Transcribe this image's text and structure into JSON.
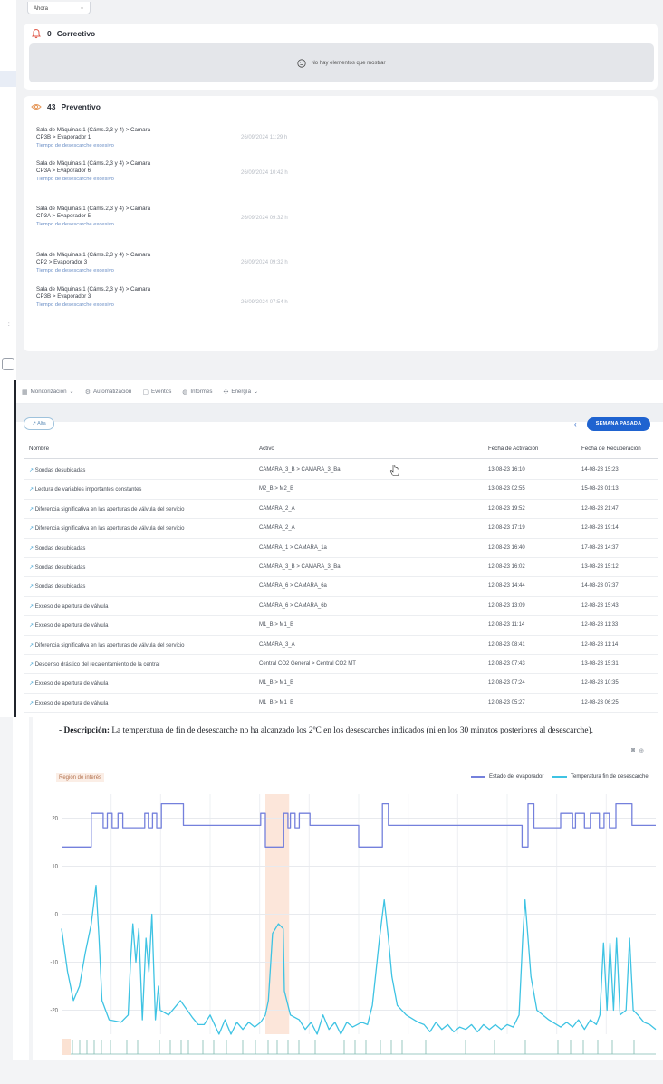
{
  "maintenance": {
    "top_select_label": "Ahora",
    "corrective": {
      "count": "0",
      "title": "Correctivo",
      "empty_text": "No hay elementos que mostrar"
    },
    "preventive": {
      "count": "43",
      "title": "Preventivo",
      "items": [
        {
          "asset": "Sala de Máquinas 1 (Cáms.2,3 y 4) > Camara CP3B > Evaporador 1",
          "type": "Tiempo de desescarche excesivo",
          "date": "26/09/2024 11:29 h"
        },
        {
          "asset": "Sala de Máquinas 1 (Cáms.2,3 y 4) > Camara CP3A > Evaporador 6",
          "type": "Tiempo de desescarche excesivo",
          "date": "26/09/2024 10:42 h"
        },
        {
          "asset": "Sala de Máquinas 1 (Cáms.2,3 y 4) > Camara CP3A > Evaporador 5",
          "type": "Tiempo de desescarche excesivo",
          "date": "26/09/2024 09:32 h"
        },
        {
          "asset": "Sala de Máquinas 1 (Cáms.2,3 y 4) > Camara CP2 > Evaporador 3",
          "type": "Tiempo de desescarche excesivo",
          "date": "26/09/2024 09:32 h"
        },
        {
          "asset": "Sala de Máquinas 1 (Cáms.2,3 y 4) > Camara CP3B > Evaporador 3",
          "type": "Tiempo de desescarche excesivo",
          "date": "26/09/2024 07:54 h"
        }
      ]
    }
  },
  "events": {
    "nav": [
      {
        "label": "Monitorización",
        "icon": "grid-icon",
        "glyph": "▦",
        "dropdown": true
      },
      {
        "label": "Automatización",
        "icon": "gear-icon",
        "glyph": "⚙",
        "dropdown": false
      },
      {
        "label": "Eventos",
        "icon": "document-icon",
        "glyph": "▢",
        "dropdown": false
      },
      {
        "label": "Informes",
        "icon": "report-icon",
        "glyph": "◍",
        "dropdown": false
      },
      {
        "label": "Energía",
        "icon": "energy-icon",
        "glyph": "✣",
        "dropdown": true
      }
    ],
    "filter_pill": "Alta",
    "week_button": "SEMANA PASADA",
    "columns": [
      "Nombre",
      "Activo",
      "Fecha de Activación",
      "Fecha de Recuperación"
    ],
    "rows": [
      {
        "name": "Sondas desubicadas",
        "asset": "CAMARA_3_B > CAMARA_3_Ba",
        "activation": "13-08-23 16:10",
        "recovery": "14-08-23 15:23"
      },
      {
        "name": "Lectura de variables importantes constantes",
        "asset": "M2_B > M2_B",
        "activation": "13-08-23 02:55",
        "recovery": "15-08-23 01:13"
      },
      {
        "name": "Diferencia significativa en las aperturas de válvula del servicio",
        "asset": "CAMARA_2_A",
        "activation": "12-08-23 19:52",
        "recovery": "12-08-23 21:47"
      },
      {
        "name": "Diferencia significativa en las aperturas de válvula del servicio",
        "asset": "CAMARA_2_A",
        "activation": "12-08-23 17:19",
        "recovery": "12-08-23 19:14"
      },
      {
        "name": "Sondas desubicadas",
        "asset": "CAMARA_1 > CAMARA_1a",
        "activation": "12-08-23 16:40",
        "recovery": "17-08-23 14:37"
      },
      {
        "name": "Sondas desubicadas",
        "asset": "CAMARA_3_B > CAMARA_3_Ba",
        "activation": "12-08-23 16:02",
        "recovery": "13-08-23 15:12"
      },
      {
        "name": "Sondas desubicadas",
        "asset": "CAMARA_6 > CAMARA_6a",
        "activation": "12-08-23 14:44",
        "recovery": "14-08-23 07:37"
      },
      {
        "name": "Exceso de apertura de válvula",
        "asset": "CAMARA_6 > CAMARA_6b",
        "activation": "12-08-23 13:09",
        "recovery": "12-08-23 15:43"
      },
      {
        "name": "Exceso de apertura de válvula",
        "asset": "M1_B > M1_B",
        "activation": "12-08-23 11:14",
        "recovery": "12-08-23 11:33"
      },
      {
        "name": "Diferencia significativa en las aperturas de válvula del servicio",
        "asset": "CAMARA_3_A",
        "activation": "12-08-23 08:41",
        "recovery": "12-08-23 11:14"
      },
      {
        "name": "Descenso drástico del recalentamiento de la central",
        "asset": "Central CO2 General > Central CO2 MT",
        "activation": "12-08-23 07:43",
        "recovery": "13-08-23 15:31"
      },
      {
        "name": "Exceso de apertura de válvula",
        "asset": "M1_B > M1_B",
        "activation": "12-08-23 07:24",
        "recovery": "12-08-23 10:35"
      },
      {
        "name": "Exceso de apertura de válvula",
        "asset": "M1_B > M1_B",
        "activation": "12-08-23 05:27",
        "recovery": "12-08-23 06:25"
      }
    ]
  },
  "report": {
    "description_label": "- Descripción:",
    "description_text": "La temperatura de fin de desescarche no ha alcanzado los 2ºC en los desescarches indicados (ni en los 30 minutos posteriores al desescarche).",
    "roi_label": "Región de interés",
    "legend": [
      "Estado del evaporador",
      "Temperatura fin de desescarche"
    ],
    "tools": [
      "camera-icon",
      "zoom-icon"
    ]
  },
  "chart_data": {
    "type": "line",
    "title": "",
    "xlabel": "",
    "ylabel": "",
    "ylim": [
      -25,
      25
    ],
    "yticks": [
      20,
      10,
      0,
      -10,
      -20
    ],
    "grid": true,
    "legend_position": "top-right",
    "x_range": [
      0,
      100
    ],
    "highlight_x": [
      [
        34.3,
        38.3
      ]
    ],
    "series": [
      {
        "name": "Estado del evaporador",
        "color": "#7480dc",
        "steps": [
          [
            0,
            14
          ],
          [
            5,
            14
          ],
          [
            5,
            21
          ],
          [
            7,
            21
          ],
          [
            7,
            18
          ],
          [
            7.7,
            18
          ],
          [
            7.7,
            21
          ],
          [
            8.5,
            21
          ],
          [
            8.5,
            18
          ],
          [
            9.5,
            18
          ],
          [
            9.5,
            21
          ],
          [
            10.3,
            21
          ],
          [
            10.3,
            18
          ],
          [
            14,
            18
          ],
          [
            14,
            21
          ],
          [
            14.6,
            21
          ],
          [
            14.6,
            18
          ],
          [
            15.3,
            18
          ],
          [
            15.3,
            21
          ],
          [
            16,
            21
          ],
          [
            16,
            18
          ],
          [
            16.8,
            18
          ],
          [
            16.8,
            23
          ],
          [
            20.5,
            23
          ],
          [
            20.5,
            18.5
          ],
          [
            33.5,
            18.5
          ],
          [
            33.5,
            21
          ],
          [
            34.3,
            21
          ],
          [
            34.3,
            14
          ],
          [
            37.4,
            14
          ],
          [
            37.4,
            21
          ],
          [
            38.1,
            21
          ],
          [
            38.1,
            18
          ],
          [
            38.5,
            18
          ],
          [
            38.5,
            21
          ],
          [
            39.3,
            21
          ],
          [
            39.3,
            18
          ],
          [
            40,
            18
          ],
          [
            40,
            21
          ],
          [
            41.8,
            21
          ],
          [
            41.8,
            18.5
          ],
          [
            50,
            18.5
          ],
          [
            50,
            14
          ],
          [
            54,
            14
          ],
          [
            54,
            23
          ],
          [
            55,
            23
          ],
          [
            55,
            18.5
          ],
          [
            77.5,
            18.5
          ],
          [
            77.5,
            14
          ],
          [
            78.5,
            14
          ],
          [
            78.5,
            23
          ],
          [
            79.5,
            23
          ],
          [
            79.5,
            18
          ],
          [
            84,
            18
          ],
          [
            84,
            21
          ],
          [
            86,
            21
          ],
          [
            86,
            18
          ],
          [
            86.5,
            18
          ],
          [
            86.5,
            21
          ],
          [
            88,
            21
          ],
          [
            88,
            18
          ],
          [
            89,
            18
          ],
          [
            89,
            21
          ],
          [
            90.5,
            21
          ],
          [
            90.5,
            18
          ],
          [
            91.3,
            18
          ],
          [
            91.3,
            21
          ],
          [
            92.2,
            21
          ],
          [
            92.2,
            18
          ],
          [
            93.3,
            18
          ],
          [
            93.3,
            23
          ],
          [
            96,
            23
          ],
          [
            96,
            18.5
          ],
          [
            100,
            18.5
          ]
        ]
      },
      {
        "name": "Temperatura fin de desescarche",
        "color": "#3ec3e3",
        "points": [
          [
            0,
            -3
          ],
          [
            1,
            -12
          ],
          [
            2,
            -18
          ],
          [
            3,
            -15
          ],
          [
            4,
            -8
          ],
          [
            5,
            -2
          ],
          [
            5.8,
            6
          ],
          [
            6.3,
            -5
          ],
          [
            6.8,
            -18
          ],
          [
            8,
            -22
          ],
          [
            10,
            -22.5
          ],
          [
            11.2,
            -21
          ],
          [
            11.6,
            -10
          ],
          [
            12,
            -2
          ],
          [
            12.5,
            -10
          ],
          [
            13,
            -3
          ],
          [
            13.6,
            -22
          ],
          [
            14.2,
            -5
          ],
          [
            14.7,
            -12
          ],
          [
            15.2,
            0
          ],
          [
            15.8,
            -22
          ],
          [
            16.3,
            -15
          ],
          [
            16.6,
            -20
          ],
          [
            18,
            -21
          ],
          [
            20,
            -18
          ],
          [
            22,
            -21.5
          ],
          [
            23,
            -23
          ],
          [
            24,
            -23
          ],
          [
            25,
            -21
          ],
          [
            26.5,
            -25
          ],
          [
            27.5,
            -22
          ],
          [
            28.5,
            -25
          ],
          [
            29.5,
            -22.5
          ],
          [
            30.5,
            -24
          ],
          [
            31.5,
            -22.5
          ],
          [
            32.5,
            -23.5
          ],
          [
            33.5,
            -22.5
          ],
          [
            34.3,
            -21
          ],
          [
            34.8,
            -18
          ],
          [
            35.5,
            -4
          ],
          [
            36.5,
            -2
          ],
          [
            37.3,
            -3
          ],
          [
            37.5,
            -16
          ],
          [
            38.5,
            -21
          ],
          [
            40,
            -22
          ],
          [
            41,
            -24
          ],
          [
            42,
            -22.5
          ],
          [
            43,
            -25
          ],
          [
            44,
            -21
          ],
          [
            45,
            -24
          ],
          [
            46,
            -22.5
          ],
          [
            47,
            -25
          ],
          [
            48,
            -22.5
          ],
          [
            49,
            -23.5
          ],
          [
            50.5,
            -22.5
          ],
          [
            51.5,
            -23
          ],
          [
            52.3,
            -19
          ],
          [
            53.5,
            -5
          ],
          [
            54.3,
            3
          ],
          [
            55,
            -5
          ],
          [
            55.6,
            -13
          ],
          [
            56.5,
            -19
          ],
          [
            58,
            -21
          ],
          [
            60,
            -22.5
          ],
          [
            61,
            -23
          ],
          [
            62,
            -24.5
          ],
          [
            63,
            -22.5
          ],
          [
            64,
            -24
          ],
          [
            65,
            -23
          ],
          [
            66,
            -24.5
          ],
          [
            67,
            -23.5
          ],
          [
            68,
            -24
          ],
          [
            69,
            -23
          ],
          [
            70,
            -24.5
          ],
          [
            71,
            -23
          ],
          [
            72,
            -24
          ],
          [
            73,
            -23
          ],
          [
            74,
            -24
          ],
          [
            75,
            -23
          ],
          [
            76,
            -23.5
          ],
          [
            77,
            -21
          ],
          [
            77.6,
            -5
          ],
          [
            78,
            3
          ],
          [
            78.5,
            -5
          ],
          [
            79,
            -13
          ],
          [
            80,
            -20
          ],
          [
            82,
            -22
          ],
          [
            84,
            -23.5
          ],
          [
            85,
            -22.5
          ],
          [
            86,
            -23.5
          ],
          [
            87,
            -22
          ],
          [
            88,
            -24
          ],
          [
            89,
            -22
          ],
          [
            90,
            -23
          ],
          [
            90.6,
            -21
          ],
          [
            91.2,
            -6
          ],
          [
            91.8,
            -20
          ],
          [
            92.3,
            -6
          ],
          [
            92.9,
            -20
          ],
          [
            93.4,
            -5
          ],
          [
            94,
            -21
          ],
          [
            95,
            -20
          ],
          [
            95.6,
            -5
          ],
          [
            96.2,
            -20
          ],
          [
            97,
            -21
          ],
          [
            98,
            -22.5
          ],
          [
            99,
            -23
          ],
          [
            100,
            -24
          ]
        ]
      }
    ]
  }
}
